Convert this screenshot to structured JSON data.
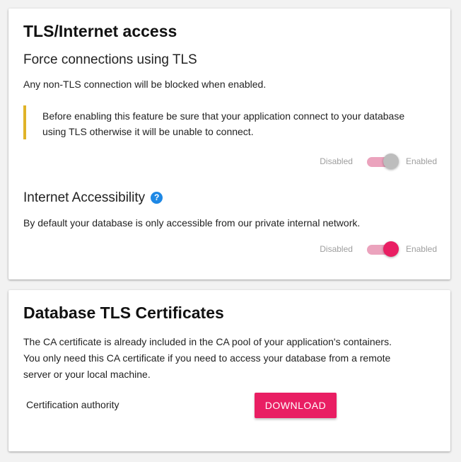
{
  "tls_card": {
    "title": "TLS/Internet access",
    "force_tls": {
      "title": "Force connections using TLS",
      "description": "Any non-TLS connection will be blocked when enabled.",
      "warning_line1": "Before enabling this feature be sure that your application connect to your database",
      "warning_line2": "using TLS otherwise it will be unable to connect.",
      "toggle": {
        "off_label": "Disabled",
        "on_label": "Enabled",
        "state": "off"
      }
    },
    "internet_access": {
      "title": "Internet Accessibility",
      "help_glyph": "?",
      "description": "By default your database is only accessible from our private internal network.",
      "toggle": {
        "off_label": "Disabled",
        "on_label": "Enabled",
        "state": "on"
      }
    }
  },
  "cert_card": {
    "title": "Database TLS Certificates",
    "text_line1": "The CA certificate is already included in the CA pool of your application's containers.",
    "text_line2": "You only need this CA certificate if you need to access your database from a remote",
    "text_line3": "server or your local machine.",
    "cert_label": "Certification authority",
    "download_label": "DOWNLOAD"
  },
  "colors": {
    "accent": "#e91e63",
    "track": "#eba3bd",
    "warning_border": "#e0b328",
    "help_icon": "#1e88e5",
    "knob_off": "#bdbdbd"
  },
  "icons": {
    "help": "help-circle-icon"
  }
}
